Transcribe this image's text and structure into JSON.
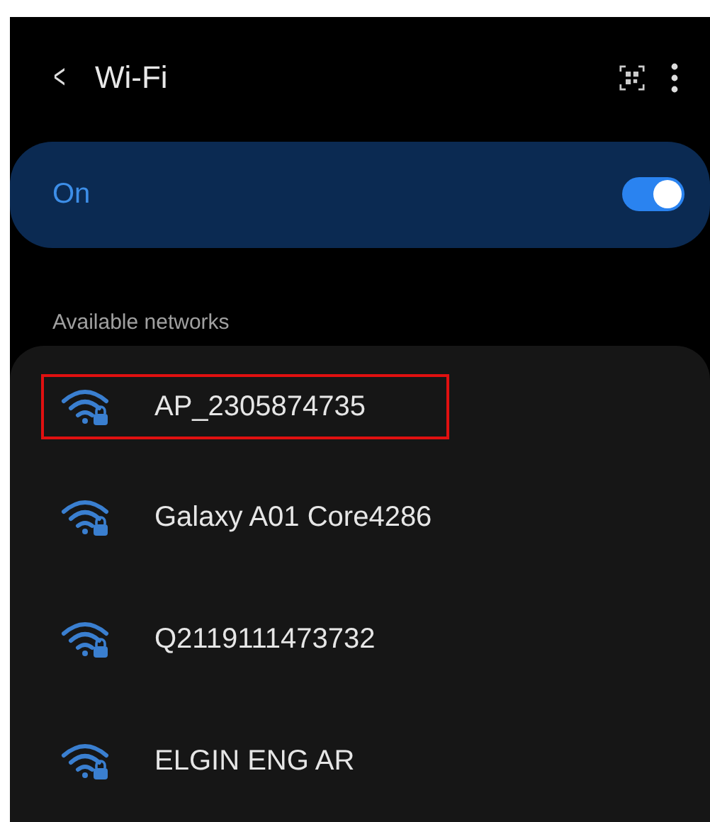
{
  "header": {
    "back": "<",
    "title": "Wi-Fi"
  },
  "master_switch": {
    "label": "On",
    "on": true
  },
  "section_title": "Available networks",
  "networks": [
    {
      "name": "AP_2305874735",
      "highlighted": true
    },
    {
      "name": "Galaxy A01 Core4286",
      "highlighted": false
    },
    {
      "name": "Q2119111473732",
      "highlighted": false
    },
    {
      "name": "ELGIN ENG AR",
      "highlighted": false
    }
  ]
}
